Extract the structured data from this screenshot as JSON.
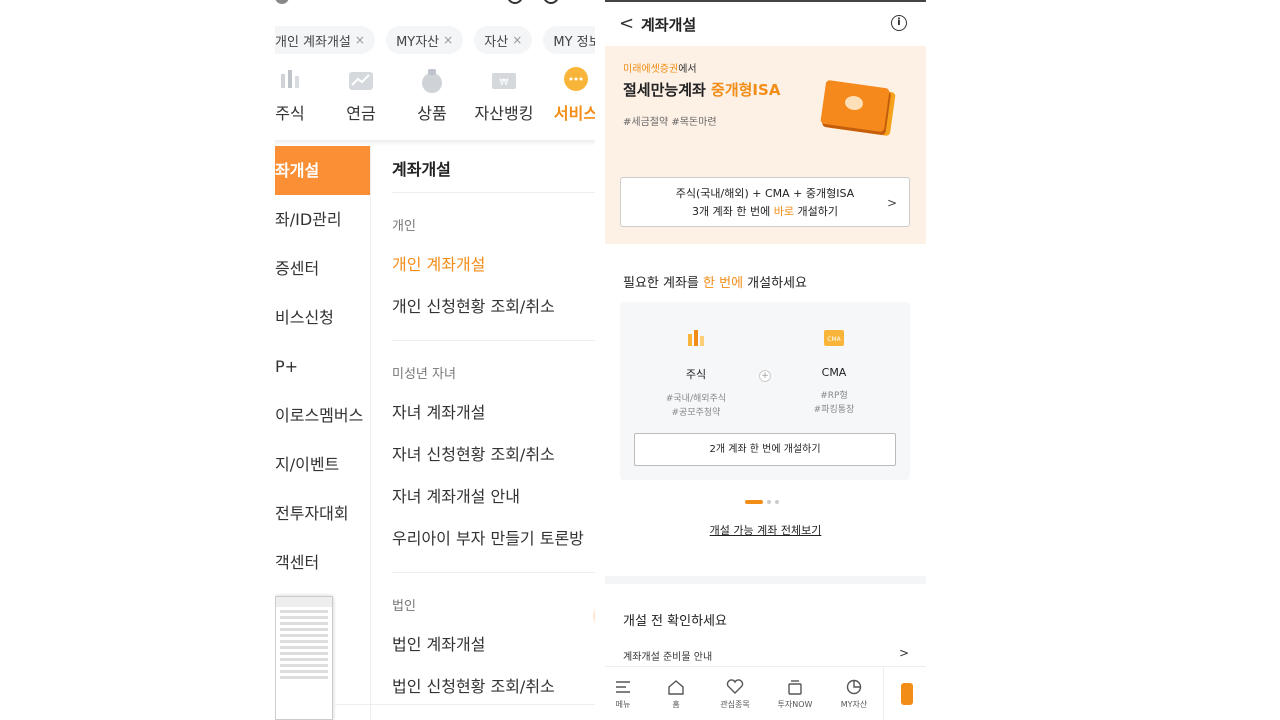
{
  "left": {
    "chips": [
      {
        "label": "개인 계좌개설"
      },
      {
        "label": "MY자산"
      },
      {
        "label": "자산"
      },
      {
        "label": "MY 정보"
      }
    ],
    "chip_close_glyph": "×",
    "categories": [
      {
        "label": "주식",
        "icon": "candlestick-icon"
      },
      {
        "label": "연금",
        "icon": "chart-line-icon"
      },
      {
        "label": "상품",
        "icon": "money-bag-icon"
      },
      {
        "label": "자산뱅킹",
        "icon": "wallet-icon"
      },
      {
        "label": "서비스",
        "icon": "chat-bubble-icon"
      }
    ],
    "sidebar": [
      "좌개설",
      "좌/ID관리",
      "증센터",
      "비스신청",
      "P+",
      "이로스멤버스",
      "지/이벤트",
      "전투자대회",
      "객센터"
    ],
    "section_title": "계좌개설",
    "groups": [
      {
        "title": "개인",
        "links": [
          "개인 계좌개설",
          "개인 신청현황 조회/취소"
        ]
      },
      {
        "title": "미성년 자녀",
        "links": [
          "자녀 계좌개설",
          "자녀 신청현황 조회/취소",
          "자녀 계좌개설 안내",
          "우리아이 부자 만들기 토론방"
        ]
      },
      {
        "title": "법인",
        "links": [
          "법인 계좌개설",
          "법인 신청현황 조회/취소"
        ]
      }
    ],
    "hot_badge": "OT"
  },
  "right": {
    "header_title": "계좌개설",
    "back_glyph": "<",
    "info_glyph": "i",
    "banner": {
      "sub_brand": "미래에셋증권",
      "sub_rest": "에서",
      "title_main": "절세만능계좌 ",
      "title_hl": "중개형ISA",
      "tags": "#세금절약 #목돈마련",
      "button_line1": "주식(국내/해외) + CMA + 중개형ISA",
      "button_line2_pre": "3개 계좌 한 번에 ",
      "button_line2_hl": "바로",
      "button_line2_post": " 개설하기",
      "chevron": ">"
    },
    "need": {
      "title_pre": "필요한 계좌를 ",
      "title_hl": "한 번에",
      "title_post": " 개설하세요",
      "products": [
        {
          "name": "주식",
          "tag1": "#국내/해외주식",
          "tag2": "#공모주청약"
        },
        {
          "name": "CMA",
          "tag1": "#RP형",
          "tag2": "#파킹통장"
        }
      ],
      "plus": "+",
      "card_button": "2개 계좌 한 번에 개설하기",
      "view_all": "개설 가능 계좌 전체보기"
    },
    "check": {
      "title": "개설 전 확인하세요",
      "row": "계좌개설 준비물 안내",
      "chevron": ">"
    },
    "tabs": [
      {
        "label": "메뉴",
        "icon": "menu-icon"
      },
      {
        "label": "홈",
        "icon": "home-icon"
      },
      {
        "label": "관심종목",
        "icon": "heart-icon"
      },
      {
        "label": "투자NOW",
        "icon": "layers-icon"
      },
      {
        "label": "MY자산",
        "icon": "pie-chart-icon"
      }
    ],
    "accent": "#f28d17",
    "banner_bg": "#fdf1e6"
  }
}
